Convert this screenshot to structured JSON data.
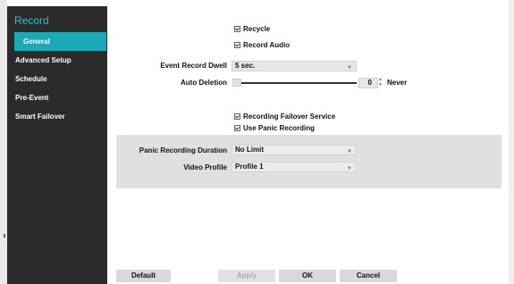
{
  "sidebar": {
    "title": "Record",
    "items": [
      {
        "label": "General",
        "active": true
      },
      {
        "label": "Advanced Setup"
      },
      {
        "label": "Schedule"
      },
      {
        "label": "Pre-Event"
      },
      {
        "label": "Smart Failover"
      }
    ]
  },
  "general": {
    "recycle_label": "Recycle",
    "record_audio_label": "Record Audio",
    "event_record_dwell_label": "Event Record Dwell",
    "event_record_dwell_value": "5 sec.",
    "auto_deletion_label": "Auto Deletion",
    "auto_deletion_value": "0",
    "auto_deletion_unit": "Never",
    "recording_failover_label": "Recording Failover Service",
    "use_panic_label": "Use Panic Recording"
  },
  "panic": {
    "duration_label": "Panic Recording Duration",
    "duration_value": "No Limit",
    "video_profile_label": "Video Profile",
    "video_profile_value": "Profile 1"
  },
  "buttons": {
    "default": "Default",
    "apply": "Apply",
    "ok": "OK",
    "cancel": "Cancel"
  },
  "colors": {
    "sidebar_bg": "#2b2b2b",
    "accent": "#1aa9b6",
    "title": "#19c8d6"
  }
}
